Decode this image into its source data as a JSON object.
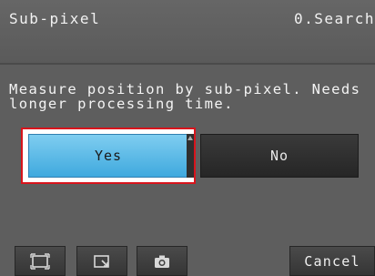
{
  "header": {
    "title": "Sub-pixel",
    "menu_label": "0.Search"
  },
  "dialog": {
    "message": "Measure position by sub-pixel. Needs\nlonger processing time.",
    "yes_label": "Yes",
    "no_label": "No",
    "selected": "Yes"
  },
  "toolbar": {
    "icons": [
      "frame-icon",
      "zoom-window-icon",
      "camera-icon"
    ],
    "cancel_label": "Cancel"
  },
  "colors": {
    "background": "#5e5e5e",
    "selected_button": "#56b8e6",
    "selection_outline": "#d8141c",
    "button_dark": "#2e2e2e"
  }
}
